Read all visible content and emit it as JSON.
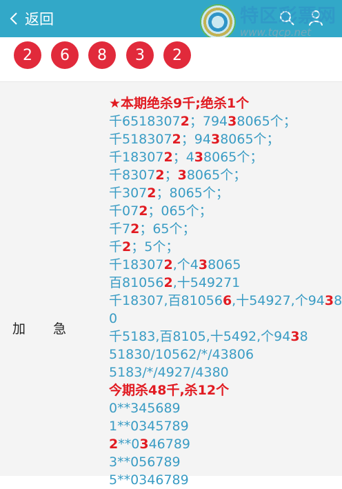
{
  "header": {
    "back_label": "返回",
    "watermark_name": "特区彩票网",
    "watermark_url": "www.tqcp.net"
  },
  "balls": [
    "2",
    "6",
    "8",
    "3",
    "2"
  ],
  "colors": {
    "header_bg": "#32a8c8",
    "ball": "#e12a3b",
    "highlight": "#e11b22",
    "text": "#3a9cc4"
  },
  "row": {
    "label_1": "加",
    "label_2": "急",
    "lines": [
      {
        "type": "head",
        "parts": [
          {
            "t": "★本期绝杀9千",
            "b": false
          },
          {
            "t": ";",
            "b": false
          },
          {
            "t": "绝杀1个",
            "b": false
          }
        ]
      },
      {
        "type": "body",
        "parts": [
          {
            "t": "千6518307",
            "b": false
          },
          {
            "t": "2",
            "b": true
          },
          {
            "t": "；794",
            "b": false
          },
          {
            "t": "3",
            "b": true
          },
          {
            "t": "8065个；",
            "b": false
          }
        ]
      },
      {
        "type": "body",
        "parts": [
          {
            "t": "千518307",
            "b": false
          },
          {
            "t": "2",
            "b": true
          },
          {
            "t": "；94",
            "b": false
          },
          {
            "t": "3",
            "b": true
          },
          {
            "t": "8065个；",
            "b": false
          }
        ]
      },
      {
        "type": "body",
        "parts": [
          {
            "t": "千18307",
            "b": false
          },
          {
            "t": "2",
            "b": true
          },
          {
            "t": "；4",
            "b": false
          },
          {
            "t": "3",
            "b": true
          },
          {
            "t": "8065个；",
            "b": false
          }
        ]
      },
      {
        "type": "body",
        "parts": [
          {
            "t": "千8307",
            "b": false
          },
          {
            "t": "2",
            "b": true
          },
          {
            "t": "；",
            "b": false
          },
          {
            "t": "3",
            "b": true
          },
          {
            "t": "8065个；",
            "b": false
          }
        ]
      },
      {
        "type": "body",
        "parts": [
          {
            "t": "千307",
            "b": false
          },
          {
            "t": "2",
            "b": true
          },
          {
            "t": "；8065个；",
            "b": false
          }
        ]
      },
      {
        "type": "body",
        "parts": [
          {
            "t": "千07",
            "b": false
          },
          {
            "t": "2",
            "b": true
          },
          {
            "t": "；065个；",
            "b": false
          }
        ]
      },
      {
        "type": "body",
        "parts": [
          {
            "t": "千7",
            "b": false
          },
          {
            "t": "2",
            "b": true
          },
          {
            "t": "；65个；",
            "b": false
          }
        ]
      },
      {
        "type": "body",
        "parts": [
          {
            "t": "千",
            "b": false
          },
          {
            "t": "2",
            "b": true
          },
          {
            "t": "；5个；",
            "b": false
          }
        ]
      },
      {
        "type": "body",
        "parts": [
          {
            "t": "千18307",
            "b": false
          },
          {
            "t": "2",
            "b": true
          },
          {
            "t": ",个4",
            "b": false
          },
          {
            "t": "3",
            "b": true
          },
          {
            "t": "8065",
            "b": false
          }
        ]
      },
      {
        "type": "body",
        "parts": [
          {
            "t": "百81056",
            "b": false
          },
          {
            "t": "2",
            "b": true
          },
          {
            "t": ",十549271",
            "b": false
          }
        ]
      },
      {
        "type": "body",
        "parts": [
          {
            "t": "千18307,百81056",
            "b": false
          },
          {
            "t": "6",
            "b": true
          },
          {
            "t": ",十54927,个94",
            "b": false
          },
          {
            "t": "3",
            "b": true
          },
          {
            "t": "8",
            "b": false
          }
        ]
      },
      {
        "type": "body",
        "parts": [
          {
            "t": "0",
            "b": false
          }
        ]
      },
      {
        "type": "body",
        "parts": [
          {
            "t": "千5183,百8105,十5492,个94",
            "b": false
          },
          {
            "t": "3",
            "b": true
          },
          {
            "t": "8",
            "b": false
          }
        ]
      },
      {
        "type": "body",
        "parts": [
          {
            "t": "51830/10562/*/43806",
            "b": false
          }
        ]
      },
      {
        "type": "body",
        "parts": [
          {
            "t": "5183/*/4927/4380",
            "b": false
          }
        ]
      },
      {
        "type": "head",
        "parts": [
          {
            "t": "今期杀48千",
            "b": false
          },
          {
            "t": ",",
            "b": false
          },
          {
            "t": "杀12个",
            "b": false
          }
        ]
      },
      {
        "type": "body",
        "parts": [
          {
            "t": "0**345689",
            "b": false
          }
        ]
      },
      {
        "type": "body",
        "parts": [
          {
            "t": "1**0345789",
            "b": false
          }
        ]
      },
      {
        "type": "body",
        "parts": [
          {
            "t": "2",
            "b": true
          },
          {
            "t": "**0",
            "b": false
          },
          {
            "t": "3",
            "b": true
          },
          {
            "t": "46789",
            "b": false
          }
        ]
      },
      {
        "type": "body",
        "parts": [
          {
            "t": "3**056789",
            "b": false
          }
        ]
      },
      {
        "type": "body",
        "parts": [
          {
            "t": "5**0346789",
            "b": false
          }
        ]
      }
    ]
  }
}
